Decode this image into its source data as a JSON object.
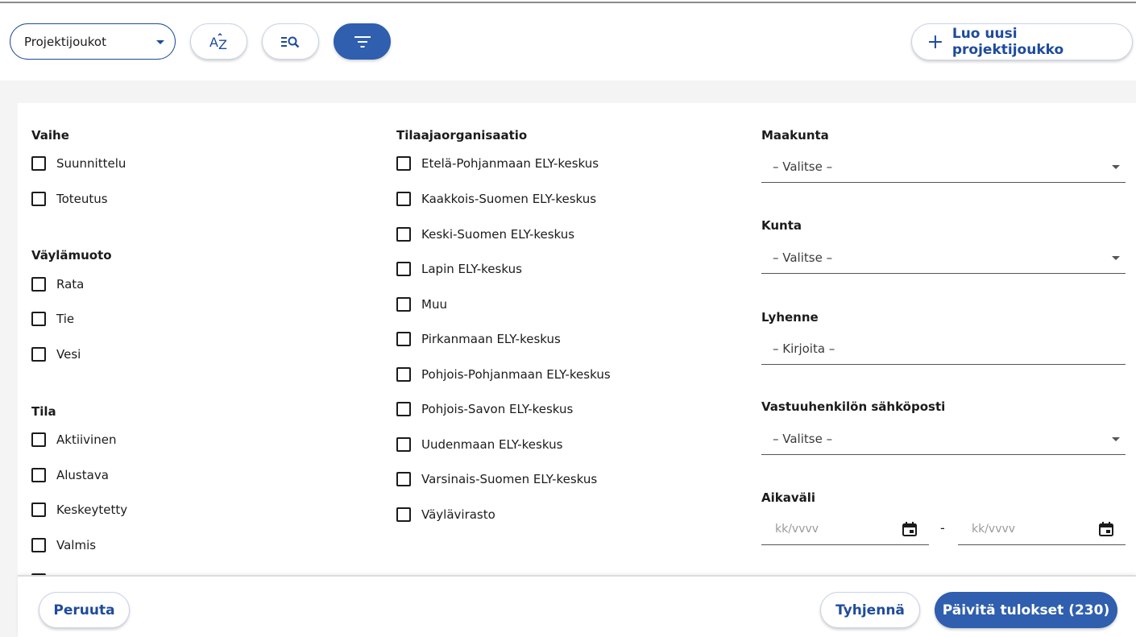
{
  "toolbar": {
    "group_select": {
      "value": "Projektijoukot"
    },
    "sort_button": {
      "icon": "sort-az-icon",
      "label": "AZ"
    },
    "search_button": {
      "icon": "search-list-icon"
    },
    "filter_button": {
      "icon": "filter-icon"
    },
    "create_button": {
      "label": "Luo uusi projektijoukko",
      "icon": "plus-icon"
    }
  },
  "filters": {
    "vaihe": {
      "title": "Vaihe",
      "options": [
        "Suunnittelu",
        "Toteutus"
      ]
    },
    "vaylamuoto": {
      "title": "Väylämuoto",
      "options": [
        "Rata",
        "Tie",
        "Vesi"
      ]
    },
    "tila": {
      "title": "Tila",
      "options": [
        "Aktiivinen",
        "Alustava",
        "Keskeytetty",
        "Valmis"
      ]
    },
    "tilaaja": {
      "title": "Tilaajaorganisaatio",
      "options": [
        "Etelä-Pohjanmaan ELY-keskus",
        "Kaakkois-Suomen ELY-keskus",
        "Keski-Suomen ELY-keskus",
        "Lapin ELY-keskus",
        "Muu",
        "Pirkanmaan ELY-keskus",
        "Pohjois-Pohjanmaan ELY-keskus",
        "Pohjois-Savon ELY-keskus",
        "Uudenmaan ELY-keskus",
        "Varsinais-Suomen ELY-keskus",
        "Väylävirasto"
      ]
    },
    "maakunta": {
      "title": "Maakunta",
      "value": "– Valitse –"
    },
    "kunta": {
      "title": "Kunta",
      "value": "– Valitse –"
    },
    "lyhenne": {
      "title": "Lyhenne",
      "placeholder": "– Kirjoita –"
    },
    "vastuuhenkilo": {
      "title": "Vastuuhenkilön sähköposti",
      "value": "– Valitse –"
    },
    "aikavali": {
      "title": "Aikaväli",
      "from_placeholder": "kk/vvvv",
      "to_placeholder": "kk/vvvv",
      "separator": "-"
    }
  },
  "footer": {
    "cancel": "Peruuta",
    "clear": "Tyhjennä",
    "update": "Päivitä tulokset (230)"
  },
  "colors": {
    "primary": "#2f5fae",
    "accent_text": "#1e4b9c"
  }
}
